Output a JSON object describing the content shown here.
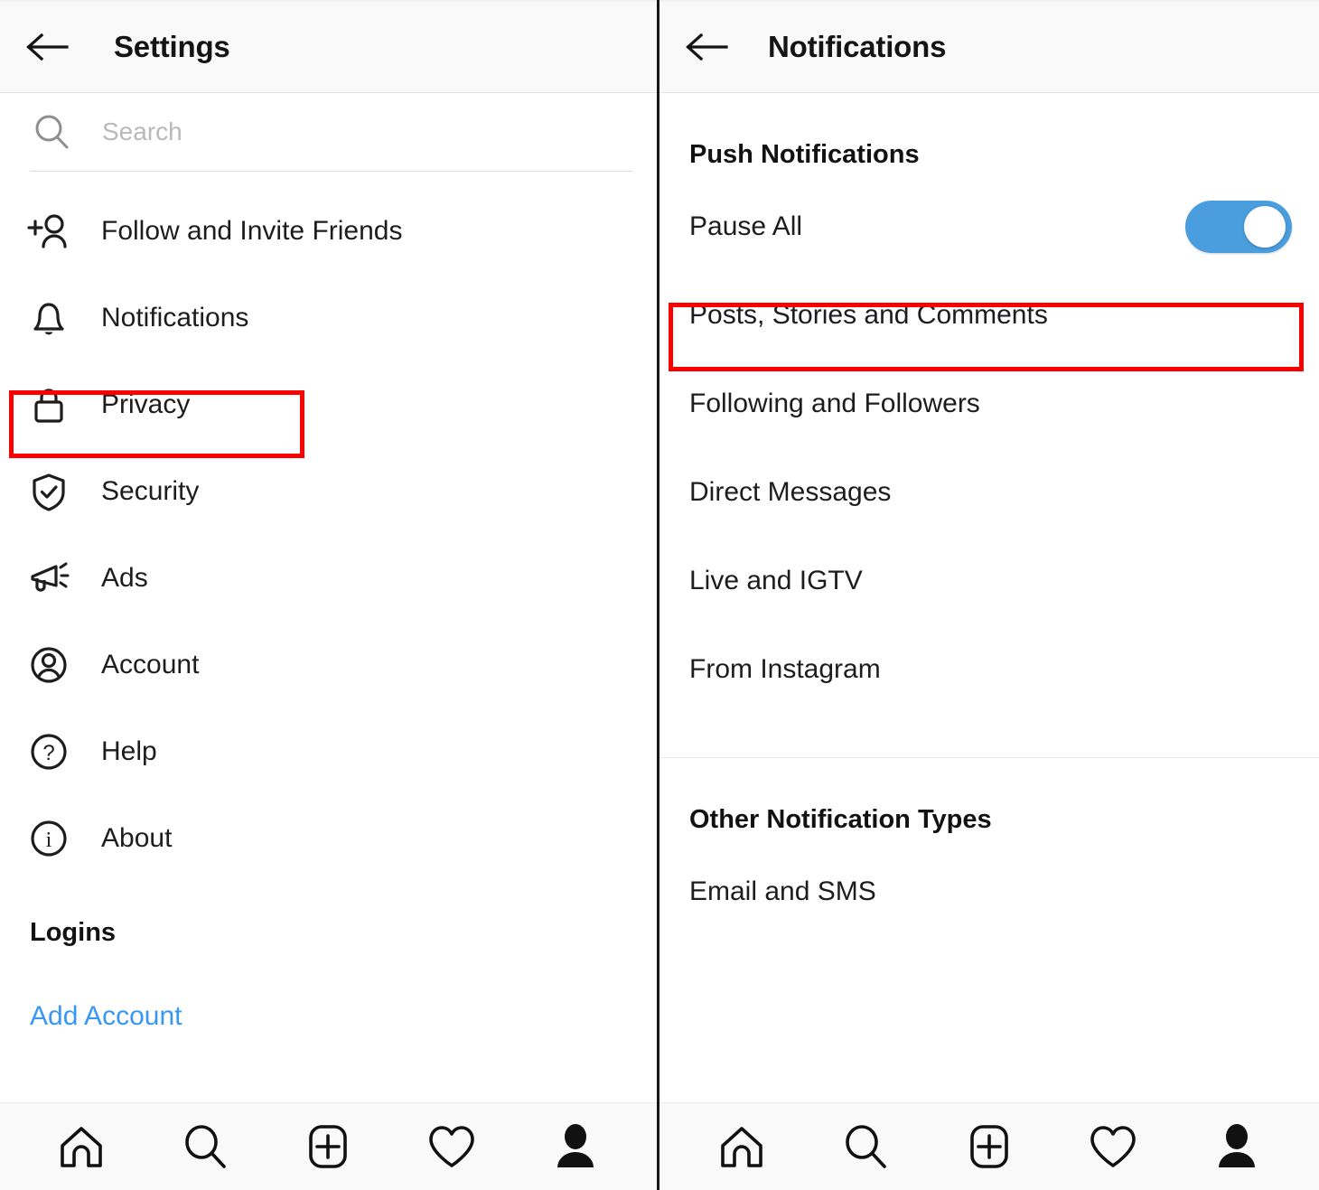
{
  "left_panel": {
    "header": {
      "back_icon": "back-arrow-icon",
      "title": "Settings"
    },
    "search": {
      "icon": "search-icon",
      "value": "",
      "placeholder": "Search"
    },
    "menu_items": [
      {
        "icon": "add-person-icon",
        "label": "Follow and Invite Friends",
        "highlighted": false
      },
      {
        "icon": "bell-icon",
        "label": "Notifications",
        "highlighted": true
      },
      {
        "icon": "lock-icon",
        "label": "Privacy",
        "highlighted": false
      },
      {
        "icon": "shield-check-icon",
        "label": "Security",
        "highlighted": false
      },
      {
        "icon": "megaphone-icon",
        "label": "Ads",
        "highlighted": false
      },
      {
        "icon": "account-circle-icon",
        "label": "Account",
        "highlighted": false
      },
      {
        "icon": "question-circle-icon",
        "label": "Help",
        "highlighted": false
      },
      {
        "icon": "info-circle-icon",
        "label": "About",
        "highlighted": false
      }
    ],
    "logins_heading": "Logins",
    "add_account_link": "Add Account"
  },
  "right_panel": {
    "header": {
      "back_icon": "back-arrow-icon",
      "title": "Notifications"
    },
    "push_section": {
      "heading": "Push Notifications",
      "pause_all": {
        "label": "Pause All",
        "toggle_on": true,
        "highlighted": true
      },
      "items": [
        {
          "label": "Posts, Stories and Comments"
        },
        {
          "label": "Following and Followers"
        },
        {
          "label": "Direct Messages"
        },
        {
          "label": "Live and IGTV"
        },
        {
          "label": "From Instagram"
        }
      ]
    },
    "other_section": {
      "heading": "Other Notification Types",
      "items": [
        {
          "label": "Email and SMS"
        }
      ]
    }
  },
  "bottom_nav": {
    "items": [
      {
        "icon": "home-icon",
        "label": "Home"
      },
      {
        "icon": "search-icon",
        "label": "Search"
      },
      {
        "icon": "add-post-icon",
        "label": "New Post"
      },
      {
        "icon": "heart-icon",
        "label": "Activity"
      },
      {
        "icon": "profile-icon",
        "label": "Profile"
      }
    ]
  },
  "colors": {
    "accent_link": "#3897f0",
    "toggle_on": "#4a9ede",
    "highlight_box": "#fc0000",
    "header_bg": "#f9f9f9",
    "text_primary": "#1d1d1d"
  }
}
